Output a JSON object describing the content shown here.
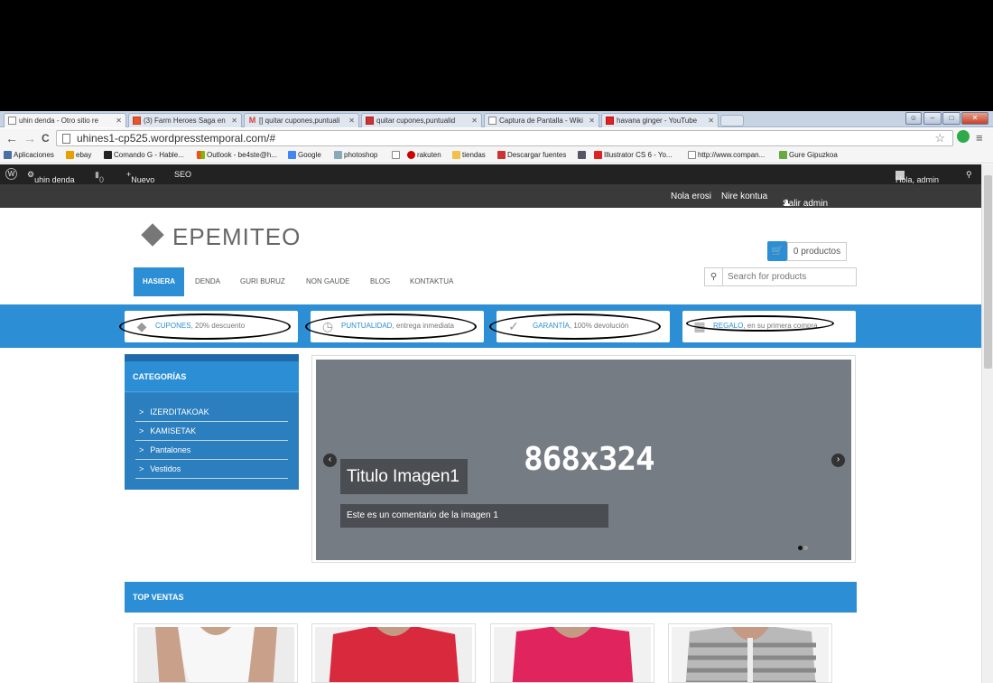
{
  "tabs": [
    {
      "title": "uhin denda - Otro sitio re",
      "active": true
    },
    {
      "title": "(3) Farm Heroes Saga en",
      "active": false
    },
    {
      "title": "[] quitar cupones,puntuali",
      "active": false
    },
    {
      "title": "quitar cupones,puntualid",
      "active": false
    },
    {
      "title": "Captura de Pantalla - Wiki",
      "active": false
    },
    {
      "title": "havana ginger - YouTube",
      "active": false
    }
  ],
  "address": {
    "url": "uhines1-cp525.wordpresstemporal.com/#"
  },
  "bookmarks": [
    "Aplicaciones",
    "ebay",
    "Comando G - Hable...",
    "Outlook - be4ste@h...",
    "Google",
    "photoshop",
    "rakuten",
    "tiendas",
    "Descargar fuentes",
    "Illustrator CS 6 - Yo...",
    "http://www.compan...",
    "Gure Gipuzkoa"
  ],
  "adminbar": {
    "site": "uhin denda",
    "comments": "0",
    "new": "Nuevo",
    "seo": "SEO",
    "greeting": "Hola, admin"
  },
  "storetop": {
    "how_to_buy": "Nola erosi",
    "account": "Nire kontua",
    "logout": "Salir admin"
  },
  "logo": "EPEMITEO",
  "nav": [
    "HASIERA",
    "DENDA",
    "GURI BURUZ",
    "NON GAUDE",
    "BLOG",
    "KONTAKTUA"
  ],
  "cart": {
    "count": "0 productos"
  },
  "search": {
    "placeholder": "Search for products"
  },
  "features": [
    {
      "title": "CUPONES",
      "text": ", 20% descuento"
    },
    {
      "title": "PUNTUALIDAD",
      "text": ", entrega inmediata"
    },
    {
      "title": "GARANTÍA",
      "text": ", 100% devolución"
    },
    {
      "title": "REGALO",
      "text": ", en su primera compra"
    }
  ],
  "categories": {
    "title": "CATEGORÍAS",
    "items": [
      "IZERDITAKOAK",
      "KAMISETAK",
      "Pantalones",
      "Vestidos"
    ]
  },
  "slider": {
    "size": "868x324",
    "title": "Titulo Imagen1",
    "caption": "Este es un comentario de la imagen 1"
  },
  "top_ventas": "TOP VENTAS",
  "colors": {
    "accent": "#2c8ed5",
    "dark_bar": "#3a3a3a",
    "admin_bar": "#222222",
    "slider_bg": "#767c83"
  }
}
